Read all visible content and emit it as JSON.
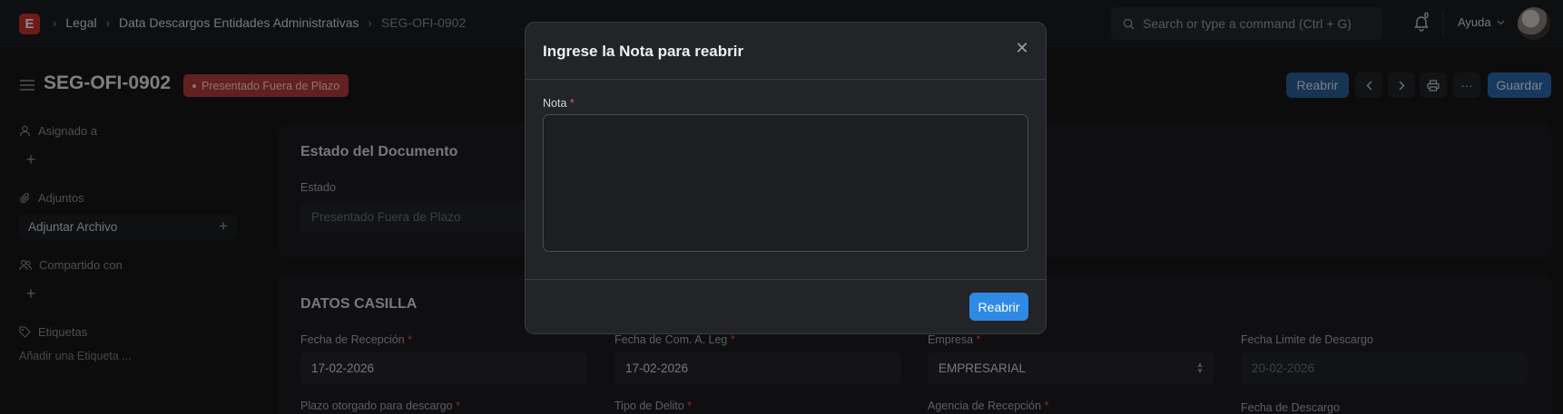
{
  "navbar": {
    "logo_letter": "E",
    "breadcrumbs": [
      "Legal",
      "Data Descargos Entidades Administrativas",
      "SEG-OFI-0902"
    ],
    "search_placeholder": "Search or type a command (Ctrl + G)",
    "notification_count": "0",
    "help_label": "Ayuda"
  },
  "header": {
    "title": "SEG-OFI-0902",
    "status": "Presentado Fuera de Plazo",
    "reopen_label": "Reabrir",
    "save_label": "Guardar",
    "more_label": "···"
  },
  "sidebar": {
    "assigned_label": "Asignado a",
    "attachments_label": "Adjuntos",
    "attach_file_label": "Adjuntar Archivo",
    "shared_label": "Compartido con",
    "tags_label": "Etiquetas",
    "add_tag_label": "Añadir una Etiqueta ..."
  },
  "document_status": {
    "title": "Estado del Documento",
    "field_label": "Estado",
    "field_value": "Presentado Fuera de Plazo"
  },
  "casilla": {
    "title": "DATOS CASILLA",
    "fields": [
      {
        "label": "Fecha de Recepción",
        "required": "*",
        "value": "17-02-2026"
      },
      {
        "label": "Fecha de Com. A. Leg",
        "required": "*",
        "value": "17-02-2026"
      },
      {
        "label": "Empresa",
        "required": "*",
        "value": "EMPRESARIAL"
      },
      {
        "label": "Fecha Limite de Descargo",
        "required": "",
        "value": "20-02-2026"
      }
    ],
    "next_row_labels": [
      {
        "label": "Plazo otorgado para descargo",
        "required": "*"
      },
      {
        "label": "Tipo de Delito",
        "required": "*"
      },
      {
        "label": "Agencia de Recepción",
        "required": "*"
      },
      {
        "label": "Fecha de Descargo",
        "required": ""
      }
    ]
  },
  "modal": {
    "title": "Ingrese la Nota para reabrir",
    "field_label": "Nota",
    "required": "*",
    "textarea_value": "",
    "submit_label": "Reabrir"
  },
  "colors": {
    "primary": "#2f8ae6",
    "status_red": "#b33b3b",
    "background": "#161719"
  }
}
